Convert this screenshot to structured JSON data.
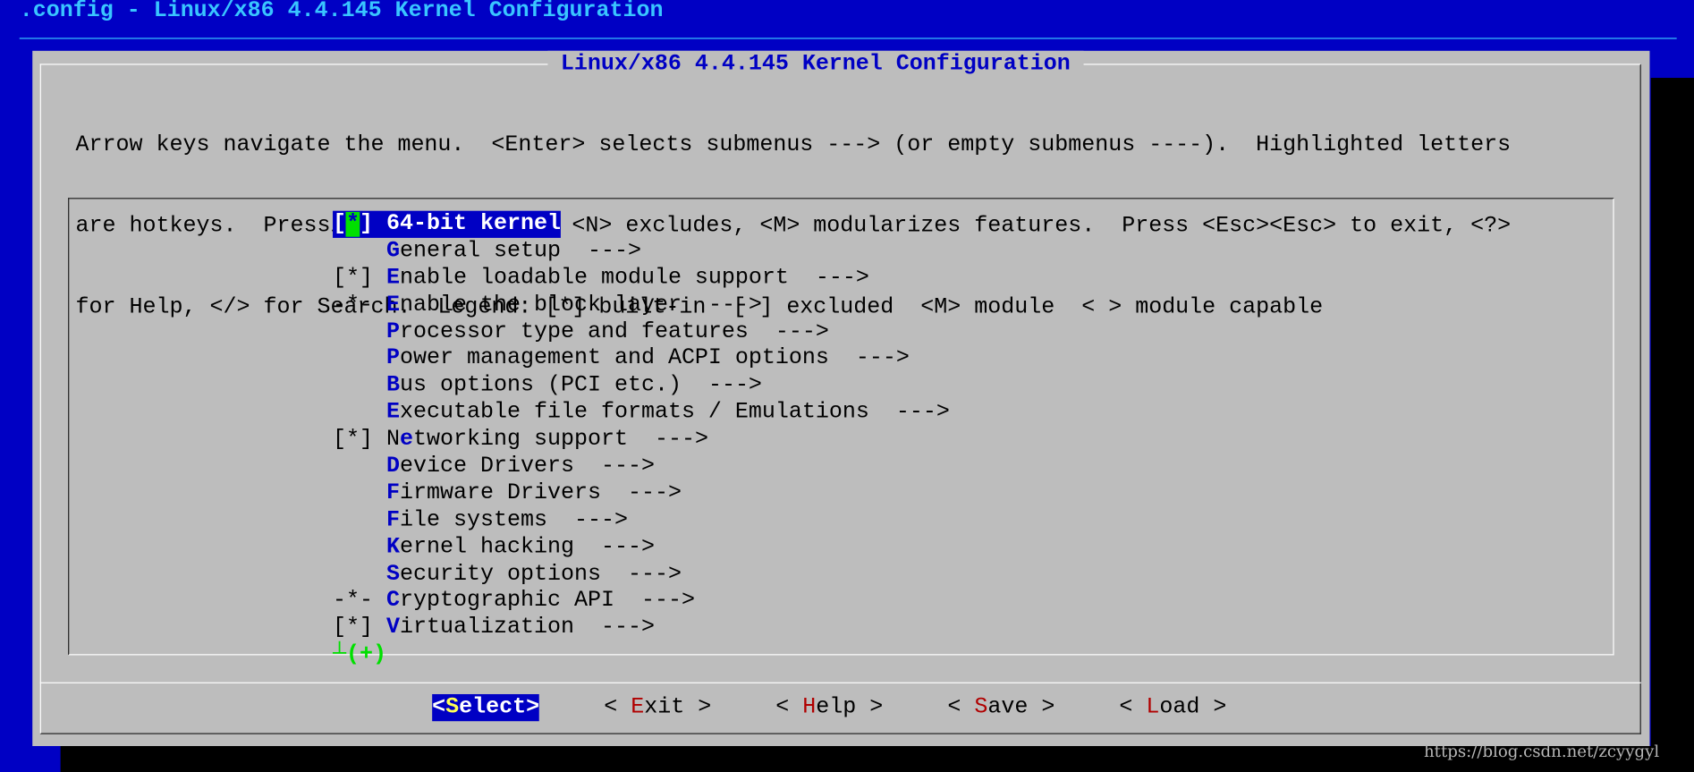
{
  "window": {
    "title": ".config - Linux/x86 4.4.145 Kernel Configuration"
  },
  "dialog": {
    "title": "Linux/x86 4.4.145 Kernel Configuration",
    "help_lines": [
      "Arrow keys navigate the menu.  <Enter> selects submenus ---> (or empty submenus ----).  Highlighted letters",
      "are hotkeys.  Pressing <Y> includes, <N> excludes, <M> modularizes features.  Press <Esc><Esc> to exit, <?>",
      "for Help, </> for Search.  Legend: [*] built-in  [ ] excluded  <M> module  < > module capable"
    ]
  },
  "menu": {
    "items": [
      {
        "prefix": "[",
        "star": "*",
        "prefix_end": "] ",
        "hotkey": "",
        "label": "64-bit kernel",
        "suffix": "",
        "selected": true
      },
      {
        "prefix": "    ",
        "hotkey": "G",
        "label": "eneral setup",
        "suffix": "  --->"
      },
      {
        "prefix": "[*] ",
        "hotkey": "E",
        "label": "nable loadable module support",
        "suffix": "  --->"
      },
      {
        "prefix": "-*- ",
        "hotkey": "E",
        "label": "nable the block layer",
        "suffix": "  --->"
      },
      {
        "prefix": "    ",
        "hotkey": "P",
        "label": "rocessor type and features",
        "suffix": "  --->"
      },
      {
        "prefix": "    ",
        "hotkey": "P",
        "label": "ower management and ACPI options",
        "suffix": "  --->"
      },
      {
        "prefix": "    ",
        "hotkey": "B",
        "label": "us options (PCI etc.)",
        "suffix": "  --->"
      },
      {
        "prefix": "    ",
        "hotkey": "E",
        "label": "xecutable file formats / Emulations",
        "suffix": "  --->"
      },
      {
        "prefix": "[*] ",
        "pre_hotkey": "N",
        "hotkey": "e",
        "label": "tworking support",
        "suffix": "  --->"
      },
      {
        "prefix": "    ",
        "hotkey": "D",
        "label": "evice Drivers",
        "suffix": "  --->"
      },
      {
        "prefix": "    ",
        "hotkey": "F",
        "label": "irmware Drivers",
        "suffix": "  --->"
      },
      {
        "prefix": "    ",
        "hotkey": "F",
        "label": "ile systems",
        "suffix": "  --->"
      },
      {
        "prefix": "    ",
        "hotkey": "K",
        "label": "ernel hacking",
        "suffix": "  --->"
      },
      {
        "prefix": "    ",
        "hotkey": "S",
        "label": "ecurity options",
        "suffix": "  --->"
      },
      {
        "prefix": "-*- ",
        "hotkey": "C",
        "label": "ryptographic API",
        "suffix": "  --->"
      },
      {
        "prefix": "[*] ",
        "hotkey": "V",
        "label": "irtualization",
        "suffix": "  --->"
      }
    ],
    "more_indicator": "┴(+)"
  },
  "buttons": [
    {
      "open": "<",
      "hotkey": "S",
      "label": "elect",
      "close": ">",
      "active": true
    },
    {
      "open": "< ",
      "hotkey": "E",
      "label": "xit",
      "close": " >",
      "active": false
    },
    {
      "open": "< ",
      "hotkey": "H",
      "label": "elp",
      "close": " >",
      "active": false
    },
    {
      "open": "< ",
      "hotkey": "S",
      "label": "ave",
      "close": " >",
      "active": false
    },
    {
      "open": "< ",
      "hotkey": "L",
      "label": "oad",
      "close": " >",
      "active": false
    }
  ],
  "watermark": "https://blog.csdn.net/zcyygyl",
  "colors": {
    "background": "#0000c4",
    "dialog": "#bdbdbd",
    "title_text": "#39c5ff",
    "hotkey": "#0000c4",
    "button_hotkey": "#b00000",
    "highlight_star": "#00e000"
  }
}
